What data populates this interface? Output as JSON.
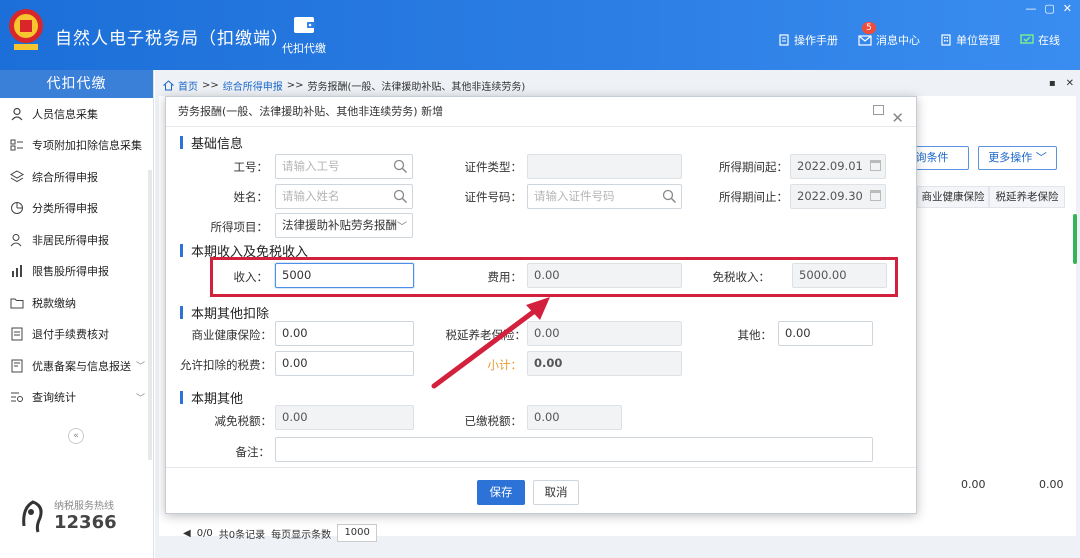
{
  "app": {
    "title": "自然人电子税务局（扣缴端）",
    "top_nav_label": "代扣代缴",
    "links": [
      {
        "label": "操作手册"
      },
      {
        "label": "消息中心",
        "badge": "5"
      },
      {
        "label": "单位管理"
      },
      {
        "label": "在线"
      }
    ]
  },
  "sidebar": {
    "header": "代扣代缴",
    "items": [
      {
        "label": "人员信息采集",
        "chevron": false
      },
      {
        "label": "专项附加扣除信息采集",
        "chevron": false
      },
      {
        "label": "综合所得申报",
        "chevron": false
      },
      {
        "label": "分类所得申报",
        "chevron": false
      },
      {
        "label": "非居民所得申报",
        "chevron": false
      },
      {
        "label": "限售股所得申报",
        "chevron": false
      },
      {
        "label": "税款缴纳",
        "chevron": false
      },
      {
        "label": "退付手续费核对",
        "chevron": false
      },
      {
        "label": "优惠备案与信息报送",
        "chevron": true
      },
      {
        "label": "查询统计",
        "chevron": true
      }
    ],
    "collapse": "«",
    "hotline_label": "纳税服务热线",
    "hotline_number": "12366"
  },
  "breadcrumb": {
    "home": "首页",
    "sep": ">>",
    "level1": "综合所得申报",
    "level2": "劳务报酬(一般、法律援助补贴、其他非连续劳务)"
  },
  "background": {
    "query_btn": "询条件",
    "more_btn": "更多操作",
    "col_health": "商业健康保险",
    "col_pension": "税延养老保险",
    "total1": "0.00",
    "total2": "0.00",
    "pager_range": "0/0",
    "pager_total": "共0条记录",
    "pager_per_page_label": "每页显示条数",
    "pager_per_page": "1000"
  },
  "modal": {
    "title": "劳务报酬(一般、法律援助补贴、其他非连续劳务) 新增",
    "section_basic": "基础信息",
    "section_income": "本期收入及免税收入",
    "section_deduct": "本期其他扣除",
    "section_other": "本期其他",
    "fields": {
      "emp_no_label": "工号：",
      "emp_no_placeholder": "请输入工号",
      "name_label": "姓名：",
      "name_placeholder": "请输入姓名",
      "income_item_label": "所得项目：",
      "income_item_value": "法律援助补贴劳务报酬",
      "id_type_label": "证件类型：",
      "id_no_label": "证件号码：",
      "id_no_placeholder": "请输入证件号码",
      "period_start_label": "所得期间起：",
      "period_start_value": "2022.09.01",
      "period_end_label": "所得期间止：",
      "period_end_value": "2022.09.30",
      "income_label": "收入：",
      "income_value": "5000",
      "expense_label": "费用：",
      "expense_value": "0.00",
      "taxfree_label": "免税收入：",
      "taxfree_value": "5000.00",
      "health_label": "商业健康保险：",
      "health_value": "0.00",
      "pension_label": "税延养老保险：",
      "pension_value": "0.00",
      "other_label": "其他：",
      "other_value": "0.00",
      "allowed_tax_label": "允许扣除的税费：",
      "allowed_tax_value": "0.00",
      "subtotal_label": "小计：",
      "subtotal_value": "0.00",
      "reduce_label": "减免税额：",
      "reduce_value": "0.00",
      "paid_label": "已缴税额：",
      "paid_value": "0.00",
      "remark_label": "备注："
    },
    "save": "保存",
    "cancel": "取消"
  },
  "colors": {
    "header_blue": "#2d7fe5",
    "primary": "#2d72d6",
    "highlight_red": "#d3213d",
    "subtotal_orange": "#e69a2b"
  }
}
